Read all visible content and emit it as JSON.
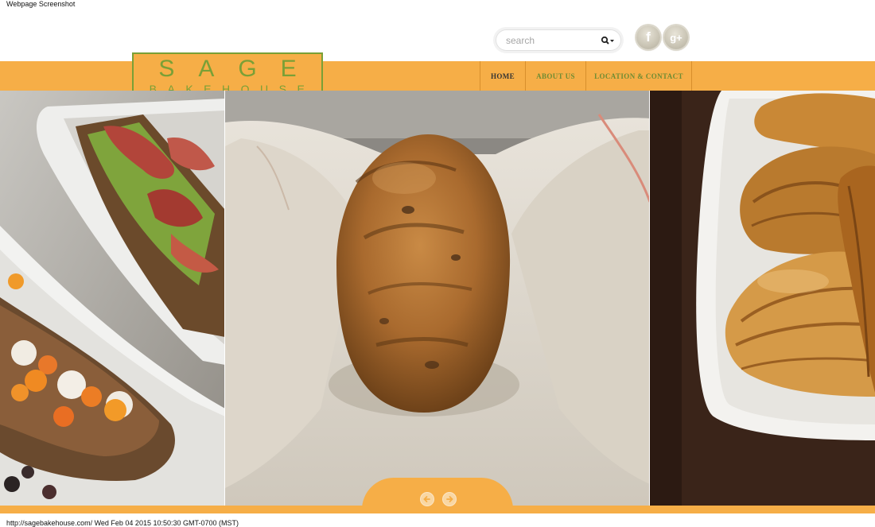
{
  "captions": {
    "top": "Webpage Screenshot",
    "bottom": "http://sagebakehouse.com/ Wed Feb 04 2015 10:50:30 GMT-0700 (MST)"
  },
  "logo": {
    "line1": "SAGE",
    "line2": "BAKEHOUSE"
  },
  "search": {
    "placeholder": "search",
    "value": "",
    "icon": "search-icon"
  },
  "social": {
    "facebook": {
      "glyph": "f",
      "icon": "facebook-icon"
    },
    "googleplus": {
      "glyph": "g+",
      "icon": "google-plus-icon"
    }
  },
  "nav": {
    "items": [
      {
        "label": "HOME",
        "active": true
      },
      {
        "label": "ABOUT US",
        "active": false
      },
      {
        "label": "LOCATION & CONTACT",
        "active": false
      }
    ]
  },
  "gallery": {
    "panels": [
      {
        "subject": "bruschetta-and-toast"
      },
      {
        "subject": "bread-loaf"
      },
      {
        "subject": "croissants"
      }
    ],
    "controls": {
      "prev_icon": "arrow-left-icon",
      "next_icon": "arrow-right-icon"
    }
  },
  "colors": {
    "accent": "#f6ae47",
    "brand_green": "#7aa036",
    "nav_text": "#6f8c33",
    "nav_active_text": "#333333"
  }
}
